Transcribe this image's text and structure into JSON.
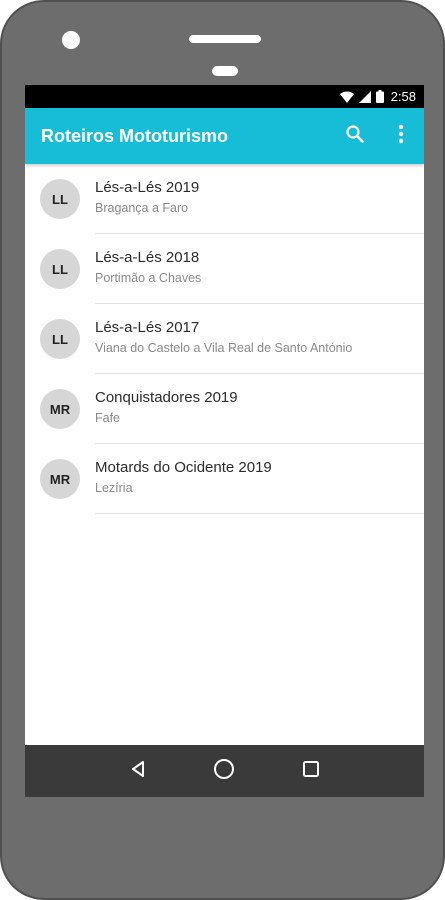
{
  "status_bar": {
    "time": "2:58",
    "icons": [
      "wifi-icon",
      "signal-icon",
      "battery-icon"
    ]
  },
  "app_bar": {
    "title": "Roteiros Mototurismo",
    "actions": [
      "search-icon",
      "more-vert-icon"
    ],
    "color": "#17bcd6"
  },
  "routes": [
    {
      "initials": "LL",
      "title": "Lés-a-Lés 2019",
      "subtitle": "Bragança a Faro"
    },
    {
      "initials": "LL",
      "title": "Lés-a-Lés 2018",
      "subtitle": "Portimão a Chaves"
    },
    {
      "initials": "LL",
      "title": "Lés-a-Lés 2017",
      "subtitle": "Viana do Castelo a Vila Real de Santo António"
    },
    {
      "initials": "MR",
      "title": "Conquistadores 2019",
      "subtitle": "Fafe"
    },
    {
      "initials": "MR",
      "title": "Motards do Ocidente 2019",
      "subtitle": "Lezíria"
    }
  ],
  "nav_bar": {
    "buttons": [
      "back-icon",
      "home-icon",
      "recents-icon"
    ]
  }
}
